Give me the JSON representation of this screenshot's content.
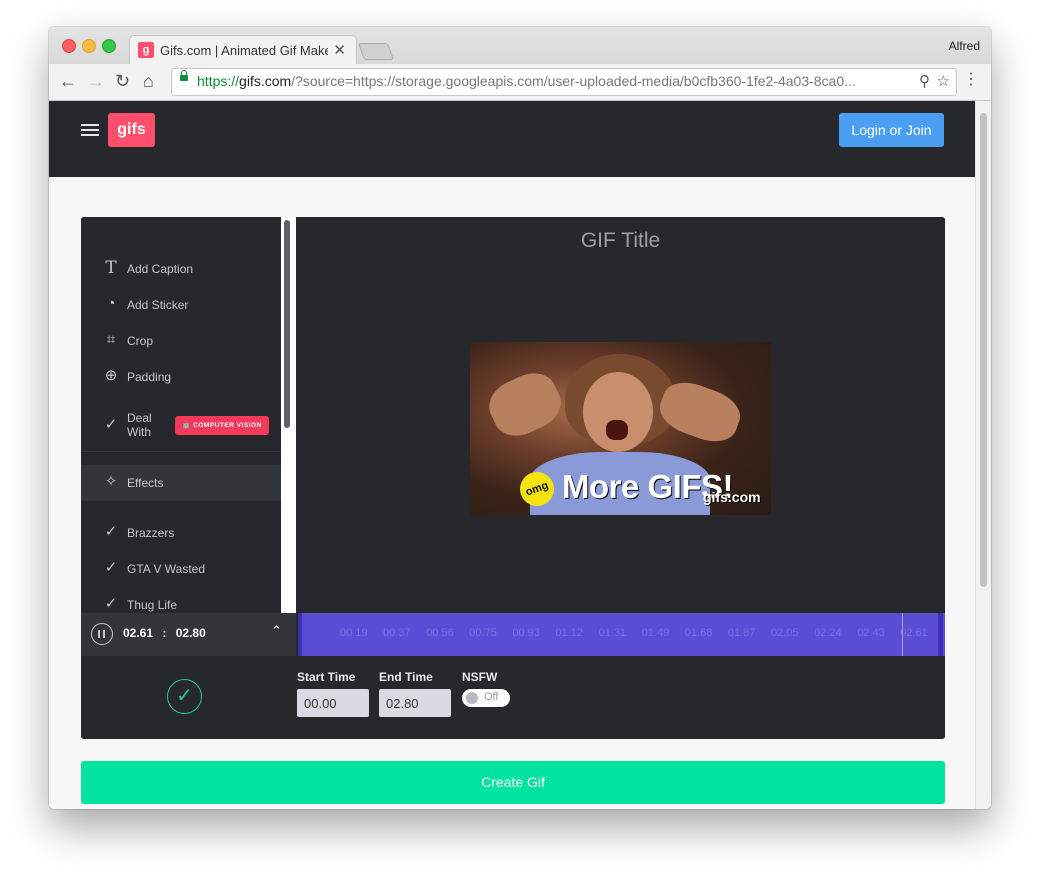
{
  "browser": {
    "tab_title": "Gifs.com | Animated Gif Maker",
    "tab_favicon": "g",
    "tab_close": "✕",
    "profile_name": "Alfred",
    "url_scheme": "https://",
    "url_host": "gifs.com",
    "url_rest": "/?source=https://storage.googleapis.com/user-uploaded-media/b0cfb360-1fe2-4a03-8ca0...",
    "icons": {
      "back": "←",
      "forward": "→",
      "reload": "↻",
      "home": "⌂",
      "zoom": "⚲",
      "star": "☆",
      "menu": "⋮"
    }
  },
  "header": {
    "logo": "gifs",
    "login_label": "Login or Join"
  },
  "sidebar": {
    "items": [
      {
        "label": "Add Caption",
        "icon": "T"
      },
      {
        "label": "Add Sticker",
        "icon": "◔"
      },
      {
        "label": "Crop",
        "icon": "⌗"
      },
      {
        "label": "Padding",
        "icon": "⊕"
      },
      {
        "label": "Deal\nWith",
        "icon": "✓"
      }
    ],
    "badge": "🤖 COMPUTER VISION",
    "effects_label": "Effects",
    "effects_icon": "✧",
    "effects": [
      {
        "label": "Brazzers",
        "icon": "✓"
      },
      {
        "label": "GTA V Wasted",
        "icon": "✓"
      },
      {
        "label": "Thug Life",
        "icon": "✓"
      }
    ]
  },
  "stage": {
    "title": "GIF Title",
    "overlay_badge": "omg",
    "overlay_text": "More GIFS!",
    "overlay_watermark": "gifs.com"
  },
  "player": {
    "current_time": "02.61",
    "separator": ":",
    "total_time": "02.80",
    "collapse_icon": "⌃"
  },
  "timeline": {
    "ticks": [
      "00.19",
      "00.37",
      "00.56",
      "00.75",
      "00.93",
      "01.12",
      "01.31",
      "01.49",
      "01.68",
      "01.87",
      "02.05",
      "02.24",
      "02.43",
      "02.61"
    ]
  },
  "controls": {
    "confirm_icon": "✓",
    "start_label": "Start Time",
    "start_value": "00.00",
    "end_label": "End Time",
    "end_value": "02.80",
    "nsfw_label": "NSFW",
    "nsfw_state": "Off"
  },
  "create_label": "Create Gif",
  "colors": {
    "brand": "#ff4f6d",
    "login": "#4a9ff5",
    "timeline": "#5c4ed4",
    "create": "#00e29f",
    "badge": "#f3395c"
  }
}
